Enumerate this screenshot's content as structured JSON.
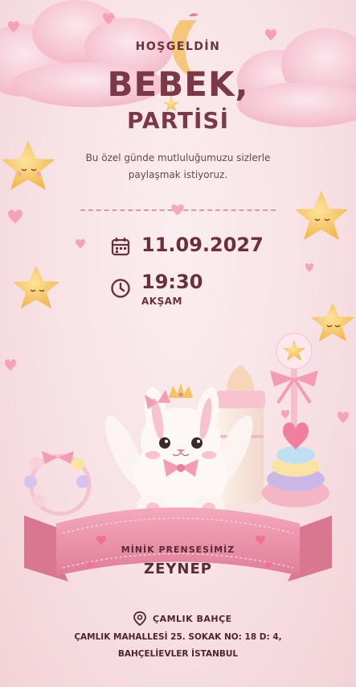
{
  "invitation": {
    "welcome": "HOŞGELDİN",
    "title_line1": "BEBEK,",
    "title_line2": "PARTİSİ",
    "message": "Bu özel günde mutluluğumuzu sizlerle paylaşmak istiyoruz.",
    "date": "11.09.2027",
    "time": "19:30",
    "period": "AKŞAM",
    "subtitle": "MİNİK PRENSESİMİZ",
    "name": "ZEYNEP",
    "venue": "ÇAMLIK BAHÇE",
    "address": "ÇAMLIK MAHALLESİ 25. SOKAK NO: 18 D: 4, BAHÇELİEVLER İSTANBUL"
  },
  "icons": {
    "calendar": "calendar-icon",
    "clock": "clock-icon",
    "location": "location-pin-icon"
  },
  "colors": {
    "background": "#f6dde1",
    "heading": "#7a3848",
    "text": "#6a4550",
    "ribbon": "#e98fa6",
    "star": "#f7c860"
  }
}
